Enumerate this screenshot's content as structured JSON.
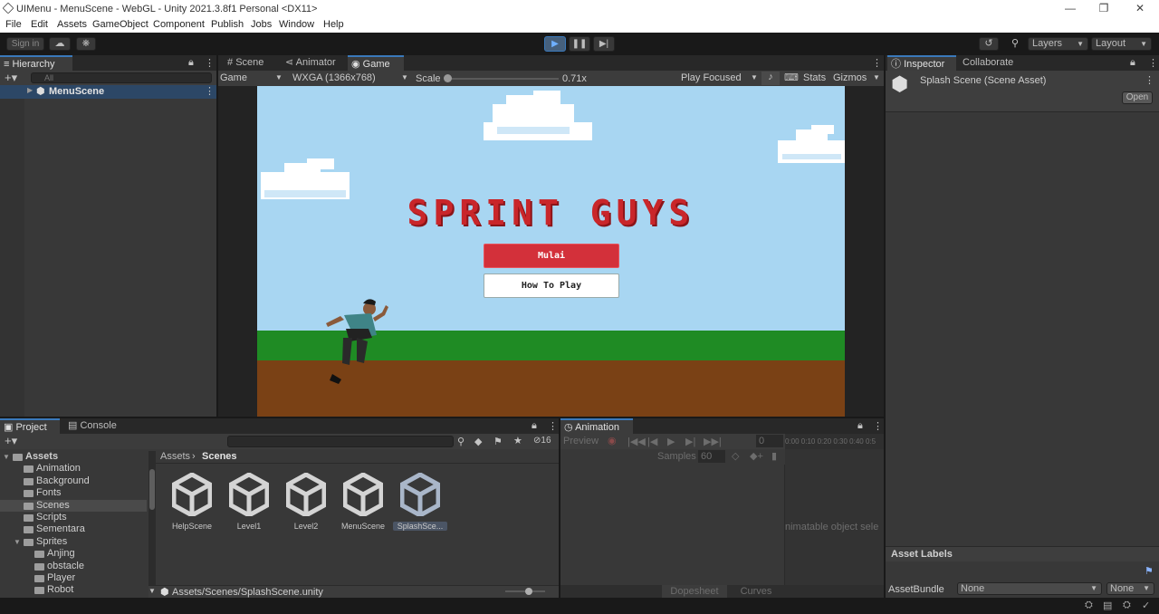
{
  "window": {
    "title": "UIMenu - MenuScene - WebGL - Unity 2021.3.8f1 Personal <DX11>"
  },
  "menu": [
    "File",
    "Edit",
    "Assets",
    "GameObject",
    "Component",
    "Publish",
    "Jobs",
    "Window",
    "Help"
  ],
  "toolbar": {
    "sign_in": "Sign in",
    "layers": "Layers",
    "layout": "Layout"
  },
  "hierarchy": {
    "tab": "Hierarchy",
    "search_placeholder": "All",
    "root": "MenuScene"
  },
  "view_tabs": {
    "scene": "Scene",
    "animator": "Animator",
    "game": "Game"
  },
  "game_bar": {
    "display": "Game",
    "resolution": "WXGA (1366x768)",
    "scale_label": "Scale",
    "scale_value": "0.71x",
    "play_mode": "Play Focused",
    "stats": "Stats",
    "gizmos": "Gizmos",
    "scale_fraction": 0.01
  },
  "game": {
    "title": "SPRINT GUYS",
    "btn_start": "Mulai",
    "btn_howto": "How To Play"
  },
  "inspector": {
    "tab": "Inspector",
    "collab": "Collaborate",
    "asset_title": "Splash Scene (Scene Asset)",
    "open_btn": "Open",
    "asset_labels": "Asset Labels",
    "asset_bundle_label": "AssetBundle",
    "bundle_value": "None",
    "variant_value": "None"
  },
  "project": {
    "tab_project": "Project",
    "tab_console": "Console",
    "hidden_count": "16",
    "breadcrumb": [
      "Assets",
      "Scenes"
    ],
    "tree": [
      {
        "label": "Assets",
        "level": 0
      },
      {
        "label": "Animation",
        "level": 1
      },
      {
        "label": "Background",
        "level": 1
      },
      {
        "label": "Fonts",
        "level": 1
      },
      {
        "label": "Scenes",
        "level": 1
      },
      {
        "label": "Scripts",
        "level": 1
      },
      {
        "label": "Sementara",
        "level": 1
      },
      {
        "label": "Sprites",
        "level": 1
      },
      {
        "label": "Anjing",
        "level": 2
      },
      {
        "label": "obstacle",
        "level": 2
      },
      {
        "label": "Player",
        "level": 2
      },
      {
        "label": "Robot",
        "level": 2
      }
    ],
    "assets": [
      "HelpScene",
      "Level1",
      "Level2",
      "MenuScene",
      "SplashSce..."
    ],
    "path": "Assets/Scenes/SplashScene.unity"
  },
  "animation": {
    "tab": "Animation",
    "preview": "Preview",
    "frame": "0",
    "samples_label": "Samples",
    "samples_value": "60",
    "ticks": "0:00 0:10 0:20 0:30 0:40 0:5",
    "hint": "nimatable object sele",
    "dopesheet": "Dopesheet",
    "curves": "Curves"
  },
  "colors": {
    "accent": "#3a79bb",
    "sky": "#a8d6f2",
    "grass": "#1f8b24",
    "dirt": "#7a4115",
    "title_red": "#c9262a",
    "button_red": "#d3303a"
  }
}
